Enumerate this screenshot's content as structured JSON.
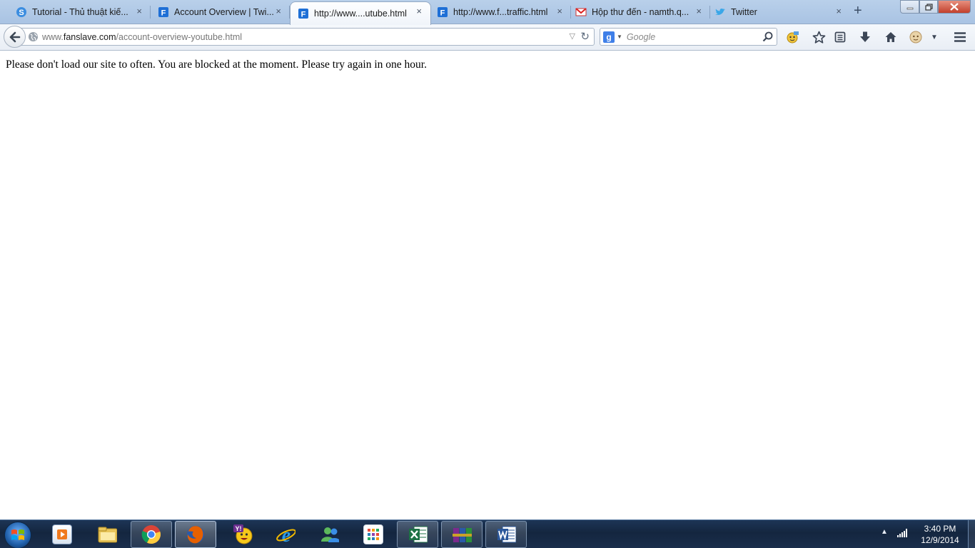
{
  "tabs": [
    {
      "title": "Tutorial - Thủ thuật kiế...",
      "icon": "tutorial-favicon",
      "active": false
    },
    {
      "title": "Account Overview | Twi...",
      "icon": "fanslave-favicon",
      "active": false
    },
    {
      "title": "http://www....utube.html",
      "icon": "fanslave-favicon",
      "active": true
    },
    {
      "title": "http://www.f...traffic.html",
      "icon": "fanslave-favicon",
      "active": false
    },
    {
      "title": "Hộp thư đến - namth.q...",
      "icon": "gmail-favicon",
      "active": false
    },
    {
      "title": "Twitter",
      "icon": "twitter-favicon",
      "active": false
    }
  ],
  "tab_close_glyph": "×",
  "new_tab_glyph": "+",
  "url": {
    "prefix": "www.",
    "host": "fanslave.com",
    "path": "/account-overview-youtube.html"
  },
  "search": {
    "placeholder": "Google",
    "engine_letter": "g"
  },
  "page": {
    "message": "Please don't load our site to often. You are blocked at the moment. Please try again in one hour."
  },
  "clock": {
    "time": "3:40 PM",
    "date": "12/9/2014"
  },
  "colors": {
    "tabstrip": "#b9d0ea",
    "taskbar": "#14263f",
    "firefox_orange": "#e66000"
  }
}
